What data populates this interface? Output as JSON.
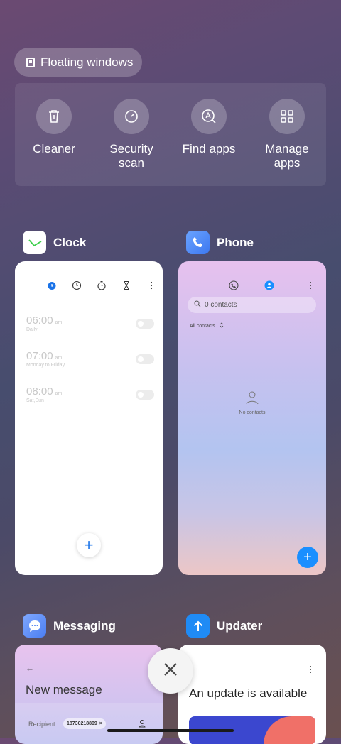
{
  "floating_windows": {
    "label": "Floating windows",
    "icon": "floating-window-icon"
  },
  "quick_actions": [
    {
      "label": "Cleaner",
      "icon": "trash-icon"
    },
    {
      "label": "Security scan",
      "label_line1": "Security",
      "label_line2": "scan",
      "icon": "shield-scan-icon"
    },
    {
      "label": "Find apps",
      "icon": "find-apps-icon"
    },
    {
      "label": "Manage apps",
      "label_line1": "Manage",
      "label_line2": "apps",
      "icon": "grid-icon"
    }
  ],
  "apps": {
    "clock": {
      "name": "Clock",
      "tabs": [
        "alarm-icon",
        "clock-icon",
        "stopwatch-icon",
        "timer-icon",
        "more-icon"
      ],
      "alarms": [
        {
          "time": "06:00",
          "ampm": "am",
          "repeat": "Daily"
        },
        {
          "time": "07:00",
          "ampm": "am",
          "repeat": "Monday to Friday"
        },
        {
          "time": "08:00",
          "ampm": "am",
          "repeat": "Sat,Sun"
        }
      ],
      "add_label": "+"
    },
    "phone": {
      "name": "Phone",
      "search_placeholder": "0 contacts",
      "filter": "All contacts",
      "empty": "No contacts",
      "add_label": "+"
    },
    "messaging": {
      "name": "Messaging",
      "title": "New message",
      "recipient_label": "Recipient:",
      "recipient_value": "18730218809",
      "back": "←"
    },
    "updater": {
      "name": "Updater",
      "title": "An update is available"
    }
  },
  "close_all": {
    "icon": "close-icon"
  },
  "colors": {
    "accent_blue": "#1a8fff",
    "clock_green": "#3ecf4c",
    "updater_blue": "#1f8bf5"
  }
}
